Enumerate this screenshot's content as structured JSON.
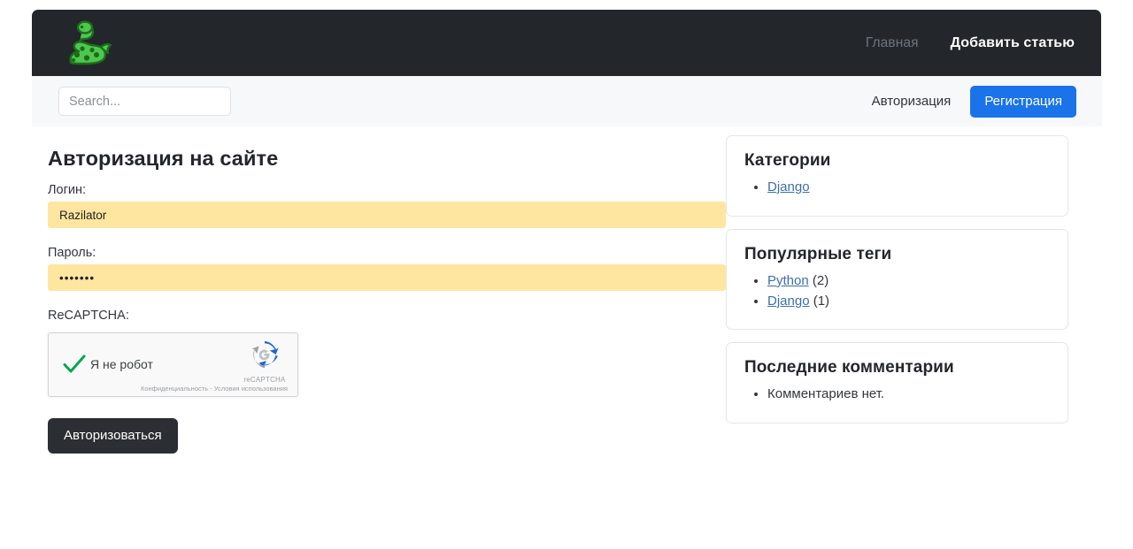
{
  "navbar": {
    "logo_icon": "green-snake-logo-icon",
    "links": [
      {
        "label": "Главная",
        "state": "muted"
      },
      {
        "label": "Добавить статью",
        "state": "active"
      }
    ]
  },
  "subbar": {
    "search": {
      "placeholder": "Search...",
      "value": ""
    },
    "auth_link": "Авторизация",
    "register_button": "Регистрация"
  },
  "main": {
    "title": "Авторизация на сайте",
    "fields": [
      {
        "label": "Логин:",
        "value": "Razilator",
        "type": "text"
      },
      {
        "label": "Пароль:",
        "value": "•••••••",
        "type": "password"
      }
    ],
    "recaptcha": {
      "label": "ReCAPTCHA:",
      "checkbox_text": "Я не робот",
      "checked": true,
      "logo_name": "reCAPTCHA",
      "footer": "Конфиденциальность - Условия использования"
    },
    "submit_button": "Авторизоваться"
  },
  "sidebar": {
    "cards": [
      {
        "title": "Категории",
        "items": [
          {
            "link": "Django",
            "count": ""
          }
        ]
      },
      {
        "title": "Популярные теги",
        "items": [
          {
            "link": "Python",
            "count": " (2)"
          },
          {
            "link": "Django",
            "count": " (1)"
          }
        ]
      },
      {
        "title": "Последние комментарии",
        "items": [
          {
            "link": "",
            "text": "Комментариев нет."
          }
        ]
      }
    ]
  },
  "colors": {
    "navbar_bg": "#23262b",
    "subbar_bg": "#f7f8fa",
    "accent_blue": "#1a73e8",
    "autofill_yellow": "#ffe6a0",
    "link_blue": "#3d6fa5",
    "check_green": "#00a84f"
  }
}
